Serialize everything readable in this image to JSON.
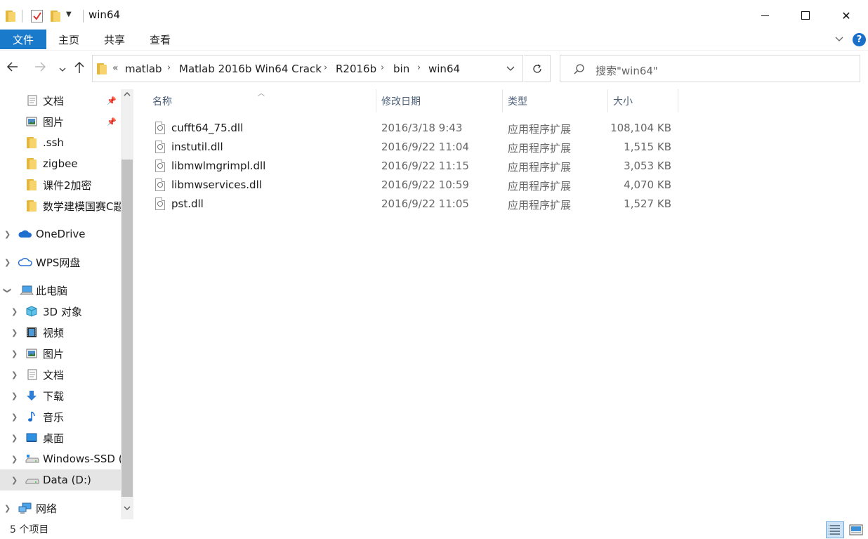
{
  "window": {
    "title": "win64",
    "controls": {
      "minimize": "minimize",
      "maximize": "maximize",
      "close": "✕"
    }
  },
  "ribbon": {
    "tabs": [
      "文件",
      "主页",
      "共享",
      "查看"
    ],
    "help": "?"
  },
  "address": {
    "overflow": "«",
    "crumbs": [
      "matlab",
      "Matlab 2016b Win64 Crack",
      "R2016b",
      "bin",
      "win64"
    ]
  },
  "search": {
    "placeholder": "搜索\"win64\""
  },
  "nav": {
    "items": [
      {
        "label": "文档",
        "icon": "document-icon",
        "pinned": true
      },
      {
        "label": "图片",
        "icon": "picture-icon",
        "pinned": true
      },
      {
        "label": ".ssh",
        "icon": "folder-icon"
      },
      {
        "label": "zigbee",
        "icon": "folder-icon"
      },
      {
        "label": "课件2加密",
        "icon": "folder-icon"
      },
      {
        "label": "数学建模国赛C题",
        "icon": "folder-icon"
      },
      {
        "label": "OneDrive",
        "icon": "cloud-icon"
      },
      {
        "label": "WPS网盘",
        "icon": "cloud-outline-icon"
      },
      {
        "label": "此电脑",
        "icon": "computer-icon"
      },
      {
        "label": "3D 对象",
        "icon": "cube-icon"
      },
      {
        "label": "视频",
        "icon": "video-icon"
      },
      {
        "label": "图片",
        "icon": "picture-icon"
      },
      {
        "label": "文档",
        "icon": "document-icon"
      },
      {
        "label": "下载",
        "icon": "download-icon"
      },
      {
        "label": "音乐",
        "icon": "music-icon"
      },
      {
        "label": "桌面",
        "icon": "desktop-icon"
      },
      {
        "label": "Windows-SSD (",
        "icon": "drive-icon"
      },
      {
        "label": "Data (D:)",
        "icon": "drive-icon",
        "selected": true
      },
      {
        "label": "网络",
        "icon": "network-icon"
      }
    ]
  },
  "columns": {
    "name": "名称",
    "date": "修改日期",
    "type": "类型",
    "size": "大小"
  },
  "files": [
    {
      "name": "cufft64_75.dll",
      "date": "2016/3/18 9:43",
      "type": "应用程序扩展",
      "size": "108,104 KB"
    },
    {
      "name": "instutil.dll",
      "date": "2016/9/22 11:04",
      "type": "应用程序扩展",
      "size": "1,515 KB"
    },
    {
      "name": "libmwlmgrimpl.dll",
      "date": "2016/9/22 11:15",
      "type": "应用程序扩展",
      "size": "3,053 KB"
    },
    {
      "name": "libmwservices.dll",
      "date": "2016/9/22 10:59",
      "type": "应用程序扩展",
      "size": "4,070 KB"
    },
    {
      "name": "pst.dll",
      "date": "2016/9/22 11:05",
      "type": "应用程序扩展",
      "size": "1,527 KB"
    }
  ],
  "status": {
    "count": "5 个项目"
  },
  "colors": {
    "accent": "#1979ca",
    "selection": "#e5e5e5",
    "header_text": "#4c607a"
  }
}
